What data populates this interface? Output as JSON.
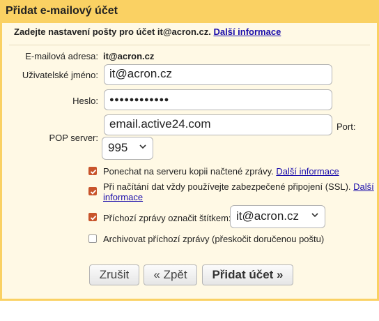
{
  "window": {
    "title": "Přidat e-mailový účet"
  },
  "intro": {
    "text": "Zadejte nastavení pošty pro účet it@acron.cz.",
    "link": "Další informace"
  },
  "form": {
    "email_label": "E-mailová adresa:",
    "email_value": "it@acron.cz",
    "username_label": "Uživatelské jméno:",
    "username_value": "it@acron.cz",
    "password_label": "Heslo:",
    "password_mask": "●●●●●●●●●●●●",
    "pop_label": "POP server:",
    "pop_value": "email.active24.com",
    "port_label": "Port:",
    "port_value": "995"
  },
  "options": [
    {
      "text": "Ponechat na serveru kopii načtené zprávy.",
      "link": "Další informace",
      "checked": true
    },
    {
      "text": "Při načítání dat vždy používejte zabezpečené připojení (SSL).",
      "link_part1": "Další",
      "link_part2": "informace",
      "checked": true
    },
    {
      "text": "Příchozí zprávy označit štítkem:",
      "select_value": "it@acron.cz",
      "checked": true
    },
    {
      "text": "Archivovat příchozí zprávy (přeskočit doručenou poštu)",
      "checked": false
    }
  ],
  "buttons": {
    "cancel": "Zrušit",
    "back": "« Zpět",
    "submit": "Přidat účet »"
  },
  "colors": {
    "header": "#fad163",
    "panel": "#fff9e5",
    "checkbox": "#c8542b",
    "link": "#1a0dab"
  }
}
